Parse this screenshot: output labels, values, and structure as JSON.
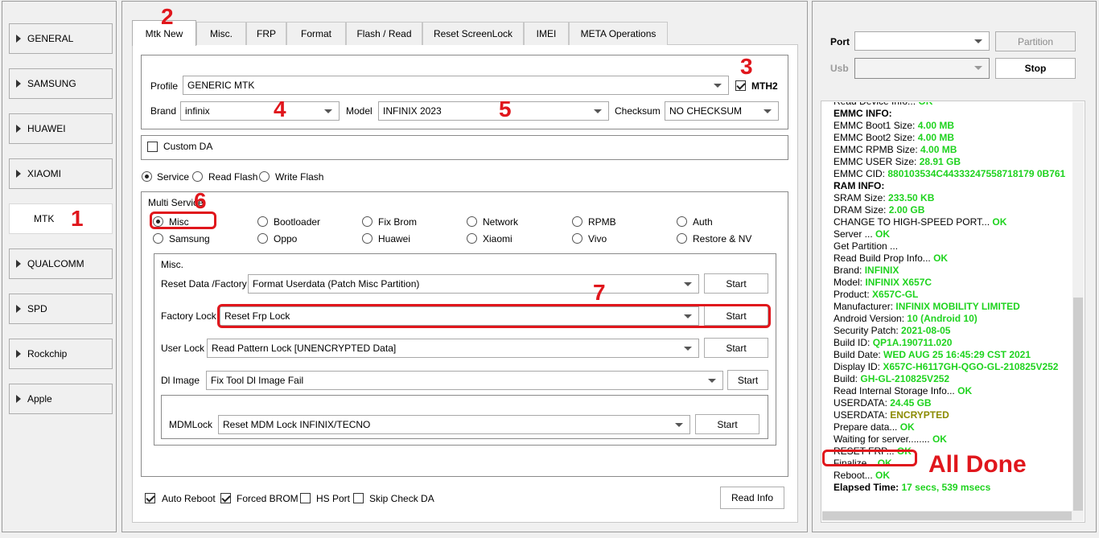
{
  "sidebar": {
    "items": [
      {
        "label": "GENERAL",
        "active": false
      },
      {
        "label": "SAMSUNG",
        "active": false
      },
      {
        "label": "HUAWEI",
        "active": false
      },
      {
        "label": "XIAOMI",
        "active": false
      },
      {
        "label": "MTK",
        "active": true
      },
      {
        "label": "QUALCOMM",
        "active": false
      },
      {
        "label": "SPD",
        "active": false
      },
      {
        "label": "Rockchip",
        "active": false
      },
      {
        "label": "Apple",
        "active": false
      }
    ]
  },
  "tabs": [
    "Mtk New",
    "Misc.",
    "FRP",
    "Format",
    "Flash / Read",
    "Reset ScreenLock",
    "IMEI",
    "META Operations"
  ],
  "profile": {
    "profile_label": "Profile",
    "profile_value": "GENERIC MTK",
    "mth2_label": "MTH2",
    "mth2_checked": true,
    "brand_label": "Brand",
    "brand_value": "infinix",
    "model_label": "Model",
    "model_value": "INFINIX 2023",
    "checksum_label": "Checksum",
    "checksum_value": "NO CHECKSUM"
  },
  "custom_da": {
    "label": "Custom DA",
    "checked": false
  },
  "mode": {
    "options": [
      "Service",
      "Read Flash",
      "Write Flash"
    ],
    "selected": "Service"
  },
  "multi_service": {
    "title": "Multi Service",
    "row1": [
      "Misc",
      "Bootloader",
      "Fix Brom",
      "Network",
      "RPMB",
      "Auth"
    ],
    "row2": [
      "Samsung",
      "Oppo",
      "Huawei",
      "Xiaomi",
      "Vivo",
      "Restore & NV"
    ],
    "selected": "Misc"
  },
  "misc": {
    "title": "Misc.",
    "reset_label": "Reset Data /Factory",
    "reset_value": "Format Userdata (Patch Misc Partition)",
    "factory_label": "Factory Lock",
    "factory_value": "Reset Frp Lock",
    "user_label": "User Lock",
    "user_value": "Read Pattern Lock [UNENCRYPTED Data]",
    "dl_label": "Dl Image",
    "dl_value": "Fix Tool Dl Image Fail",
    "mdm_label": "MDMLock",
    "mdm_value": "Reset MDM Lock INFINIX/TECNO",
    "start_label": "Start"
  },
  "bottom": {
    "auto_reboot": "Auto Reboot",
    "forced_brom": "Forced BROM",
    "hs_port": "HS Port",
    "skip_check_da": "Skip Check DA",
    "read_info": "Read Info"
  },
  "right": {
    "port_label": "Port",
    "usb_label": "Usb",
    "partition_label": "Partition",
    "stop_label": "Stop"
  },
  "log": [
    [
      {
        "t": "Read Device Info... ",
        "c": ""
      },
      {
        "t": "OK",
        "c": "g"
      }
    ],
    [
      {
        "t": "EMMC INFO:",
        "c": "b"
      }
    ],
    [
      {
        "t": "EMMC Boot1 Size: ",
        "c": ""
      },
      {
        "t": "4.00 MB",
        "c": "g"
      }
    ],
    [
      {
        "t": "EMMC Boot2 Size: ",
        "c": ""
      },
      {
        "t": "4.00 MB",
        "c": "g"
      }
    ],
    [
      {
        "t": "EMMC RPMB Size: ",
        "c": ""
      },
      {
        "t": "4.00 MB",
        "c": "g"
      }
    ],
    [
      {
        "t": "EMMC USER Size: ",
        "c": ""
      },
      {
        "t": "28.91 GB",
        "c": "g"
      }
    ],
    [
      {
        "t": "EMMC CID: ",
        "c": ""
      },
      {
        "t": "880103534C44333247558718179 0B761",
        "c": "g"
      }
    ],
    [
      {
        "t": "RAM INFO:",
        "c": "b"
      }
    ],
    [
      {
        "t": "SRAM Size: ",
        "c": ""
      },
      {
        "t": "233.50 KB",
        "c": "g"
      }
    ],
    [
      {
        "t": "DRAM Size: ",
        "c": ""
      },
      {
        "t": "2.00 GB",
        "c": "g"
      }
    ],
    [
      {
        "t": "CHANGE TO HIGH-SPEED PORT... ",
        "c": ""
      },
      {
        "t": "OK",
        "c": "g"
      }
    ],
    [
      {
        "t": "Server ... ",
        "c": ""
      },
      {
        "t": "OK",
        "c": "g"
      }
    ],
    [
      {
        "t": "Get Partition ...",
        "c": ""
      }
    ],
    [
      {
        "t": "Read Build Prop Info... ",
        "c": ""
      },
      {
        "t": "OK",
        "c": "g"
      }
    ],
    [
      {
        "t": " Brand: ",
        "c": ""
      },
      {
        "t": "INFINIX",
        "c": "g"
      }
    ],
    [
      {
        "t": " Model: ",
        "c": ""
      },
      {
        "t": "INFINIX X657C",
        "c": "g"
      }
    ],
    [
      {
        "t": " Product: ",
        "c": ""
      },
      {
        "t": "X657C-GL",
        "c": "g"
      }
    ],
    [
      {
        "t": " Manufacturer: ",
        "c": ""
      },
      {
        "t": "INFINIX MOBILITY LIMITED",
        "c": "g"
      }
    ],
    [
      {
        "t": " Android Version: ",
        "c": ""
      },
      {
        "t": "10 (Android 10)",
        "c": "g"
      }
    ],
    [
      {
        "t": " Security Patch: ",
        "c": ""
      },
      {
        "t": "2021-08-05",
        "c": "g"
      }
    ],
    [
      {
        "t": " Build ID: ",
        "c": ""
      },
      {
        "t": "QP1A.190711.020",
        "c": "g"
      }
    ],
    [
      {
        "t": " Build Date: ",
        "c": ""
      },
      {
        "t": "WED AUG 25 16:45:29 CST 2021",
        "c": "g"
      }
    ],
    [
      {
        "t": " Display ID: ",
        "c": ""
      },
      {
        "t": "X657C-H6117GH-QGO-GL-210825V252",
        "c": "g"
      }
    ],
    [
      {
        "t": " Build: ",
        "c": ""
      },
      {
        "t": "GH-GL-210825V252",
        "c": "g"
      }
    ],
    [
      {
        "t": "Read Internal Storage Info... ",
        "c": ""
      },
      {
        "t": "OK",
        "c": "g"
      }
    ],
    [
      {
        "t": "USERDATA: ",
        "c": ""
      },
      {
        "t": "24.45 GB",
        "c": "g"
      }
    ],
    [
      {
        "t": "USERDATA: ",
        "c": ""
      },
      {
        "t": "ENCRYPTED",
        "c": "o"
      }
    ],
    [
      {
        "t": "Prepare data... ",
        "c": ""
      },
      {
        "t": "OK",
        "c": "g"
      }
    ],
    [
      {
        "t": "Waiting for server........ ",
        "c": ""
      },
      {
        "t": "OK",
        "c": "g"
      }
    ],
    [
      {
        "t": "RESET FRP... ",
        "c": ""
      },
      {
        "t": "OK",
        "c": "g"
      }
    ],
    [
      {
        "t": "Finalize... ",
        "c": ""
      },
      {
        "t": "OK",
        "c": "g"
      }
    ],
    [
      {
        "t": "Reboot... ",
        "c": ""
      },
      {
        "t": "OK",
        "c": "g"
      }
    ],
    [
      {
        "t": "Elapsed Time: ",
        "c": "b"
      },
      {
        "t": "17 secs, 539 msecs",
        "c": "g"
      }
    ]
  ],
  "annotations": {
    "n1": "1",
    "n2": "2",
    "n3": "3",
    "n4": "4",
    "n5": "5",
    "n6": "6",
    "n7": "7",
    "all_done": "All Done"
  },
  "colors": {
    "annotation": "#e0161c",
    "ok": "#1fd31f",
    "encrypted": "#8b8b00"
  }
}
